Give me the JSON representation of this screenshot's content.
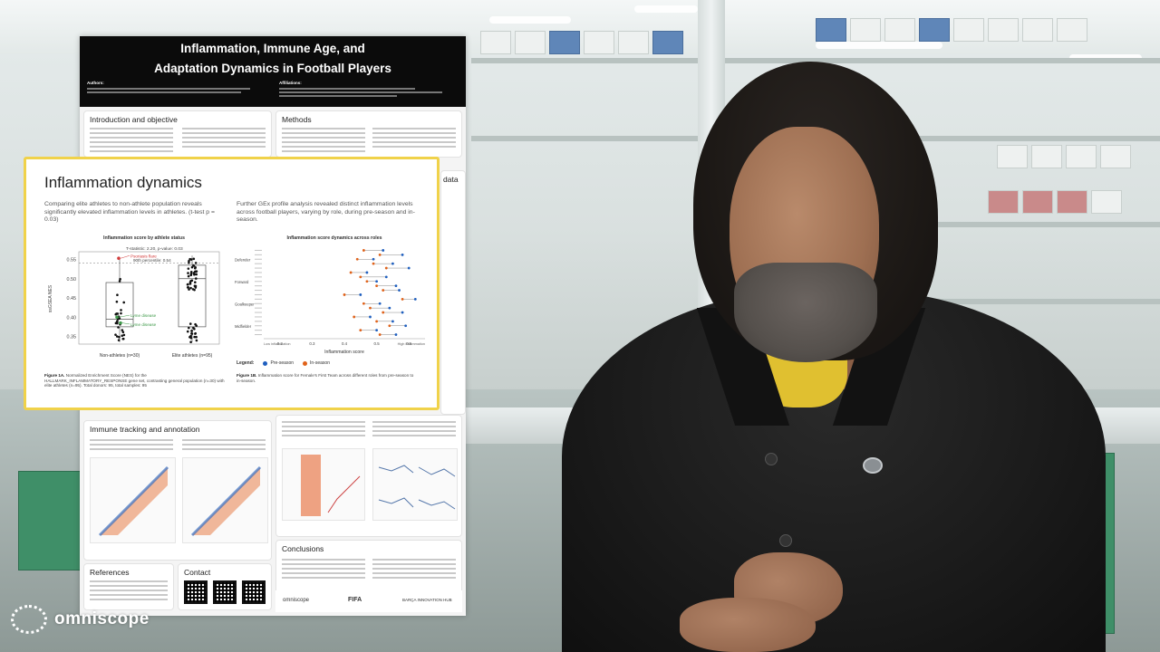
{
  "brand": {
    "name": "omniscope"
  },
  "poster": {
    "title_line1": "Inflammation, Immune Age, and",
    "title_line2": "Adaptation Dynamics in Football Players",
    "authors_label": "Authors:",
    "affiliations_label": "Affiliations:",
    "sections": {
      "intro": "Introduction and objective",
      "methods": "Methods",
      "data_fragment": "data",
      "immune": "Immune tracking and annotation",
      "conclusions": "Conclusions",
      "references": "References",
      "contact": "Contact"
    },
    "footer_logos": [
      "omniscope",
      "FIFA",
      "BARÇA INNOVATION HUB"
    ]
  },
  "callout": {
    "title": "Inflammation dynamics",
    "left_text": "Comparing elite athletes to non-athlete population reveals significantly elevated inflammation levels in athletes. (t-test p = 0.03)",
    "right_text": "Further GEx profile analysis revealed distinct inflammation levels across football players, varying by role, during pre-season and in-season.",
    "left_chart": {
      "title": "Inflammation score by athlete status",
      "stat_label": "T-statistic: 2.20, p-value: 0.03",
      "percentile_label": "90th percentile: 0.54",
      "annotations": [
        "Psoriasis flare",
        "Lyme disease",
        "Lyme disease"
      ],
      "ylabel": "ssGSEA NES",
      "yticks": [
        "0.55",
        "0.50",
        "0.45",
        "0.40",
        "0.35"
      ],
      "xlabels": [
        "Non-athletes (n=30)",
        "Elite athletes (n=95)"
      ]
    },
    "right_chart": {
      "title": "Inflammation score dynamics across roles",
      "roles": [
        "Defender",
        "Forward",
        "Goalkeeper",
        "Midfielder"
      ],
      "xlabel": "Inflammation score",
      "xaxis_left": "Low inflammation",
      "xaxis_right": "High inflammation",
      "xticks": [
        "0.2",
        "0.3",
        "0.4",
        "0.5",
        "0.6"
      ],
      "legend_label": "Legend:",
      "legend": [
        "Pre-season",
        "In-season"
      ]
    },
    "left_caption_bold": "Figure 1A.",
    "left_caption": " Normalized Enrichment Score (NES) for the HALLMARK_INFLAMMATORY_RESPONSE gene set, contrasting general population (n=30) with elite athletes (n=95). Total donors: 95, total samples: 95",
    "right_caption_bold": "Figure 1B.",
    "right_caption": " Inflammation score for Female's First Team across different roles from pre-season to in-season."
  },
  "colors": {
    "callout_border": "#f0d24a",
    "pre_season": "#1f5fbf",
    "in_season": "#e0621a",
    "annotation_red": "#d23b3b",
    "annotation_green": "#3f9a4a"
  },
  "chart_data": [
    {
      "type": "box",
      "title": "Inflammation score by athlete status",
      "categories": [
        "Non-athletes (n=30)",
        "Elite athletes (n=95)"
      ],
      "ylabel": "ssGSEA NES",
      "ylim": [
        0.33,
        0.57
      ],
      "boxes": [
        {
          "name": "Non-athletes (n=30)",
          "q1": 0.375,
          "median": 0.395,
          "q3": 0.49,
          "whisker_low": 0.335,
          "whisker_high": 0.555
        },
        {
          "name": "Elite athletes (n=95)",
          "q1": 0.375,
          "median": 0.5,
          "q3": 0.535,
          "whisker_low": 0.335,
          "whisker_high": 0.56
        }
      ],
      "reference_line": 0.54,
      "annotations": [
        "T-statistic: 2.20, p-value: 0.03",
        "90th percentile: 0.54",
        "Psoriasis flare",
        "Lyme disease",
        "Lyme disease"
      ]
    },
    {
      "type": "dumbbell",
      "title": "Inflammation score dynamics across roles",
      "xlabel": "Inflammation score",
      "xlim": [
        0.15,
        0.65
      ],
      "series": [
        {
          "name": "Pre-season",
          "values": [
            0.52,
            0.58,
            0.49,
            0.55,
            0.6,
            0.47,
            0.53,
            0.5,
            0.56,
            0.57,
            0.45,
            0.62,
            0.51,
            0.54,
            0.58,
            0.48,
            0.55,
            0.59,
            0.5,
            0.56
          ]
        },
        {
          "name": "In-season",
          "values": [
            0.46,
            0.51,
            0.44,
            0.49,
            0.53,
            0.42,
            0.45,
            0.47,
            0.5,
            0.52,
            0.4,
            0.58,
            0.46,
            0.48,
            0.52,
            0.43,
            0.5,
            0.54,
            0.45,
            0.51
          ]
        }
      ],
      "groups": [
        "Defender",
        "Forward",
        "Goalkeeper",
        "Midfielder"
      ],
      "legend": [
        "Pre-season",
        "In-season"
      ]
    }
  ]
}
